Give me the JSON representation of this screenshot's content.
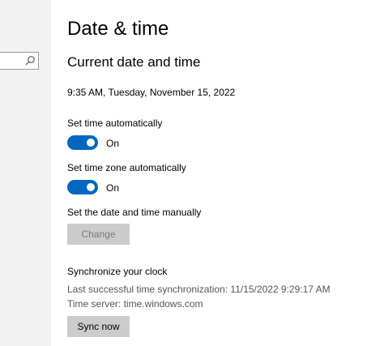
{
  "page": {
    "title": "Date & time"
  },
  "colors": {
    "accent": "#0067c0",
    "sidebar_bg": "#f2f2f2",
    "button_bg": "#cccccc",
    "secondary_text": "#555555"
  },
  "current": {
    "heading": "Current date and time",
    "datetime": "9:35 AM, Tuesday, November 15, 2022"
  },
  "auto_time": {
    "label": "Set time automatically",
    "state": "On",
    "enabled": true
  },
  "auto_timezone": {
    "label": "Set time zone automatically",
    "state": "On",
    "enabled": true
  },
  "manual": {
    "label": "Set the date and time manually",
    "button_label": "Change",
    "button_disabled": true
  },
  "sync": {
    "heading": "Synchronize your clock",
    "last_sync": "Last successful time synchronization: 11/15/2022 9:29:17 AM",
    "time_server": "Time server: time.windows.com",
    "button_label": "Sync now"
  },
  "sidebar": {
    "search_icon": "search-icon"
  }
}
